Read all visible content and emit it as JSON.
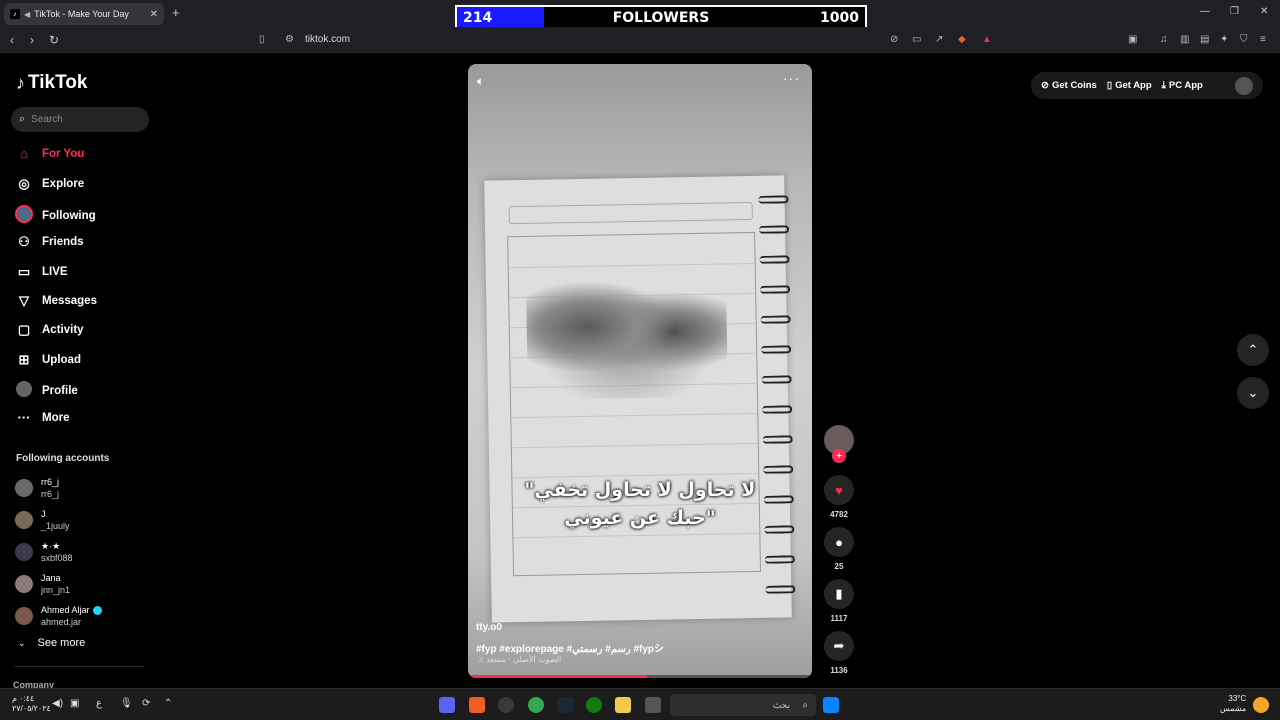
{
  "browser": {
    "tab_title": "TikTok - Make Your Day",
    "url": "tiktok.com"
  },
  "overlay": {
    "current": "214",
    "label": "FOLLOWERS",
    "goal": "1000",
    "progress": 0.214
  },
  "sidebar": {
    "logo": "TikTok",
    "search_placeholder": "Search",
    "nav": [
      {
        "label": "For You",
        "icon": "home-icon"
      },
      {
        "label": "Explore",
        "icon": "compass-icon"
      },
      {
        "label": "Following",
        "icon": "following-avatar-icon"
      },
      {
        "label": "Friends",
        "icon": "friends-icon"
      },
      {
        "label": "LIVE",
        "icon": "live-tv-icon"
      },
      {
        "label": "Messages",
        "icon": "send-icon"
      },
      {
        "label": "Activity",
        "icon": "activity-icon"
      },
      {
        "label": "Upload",
        "icon": "plus-square-icon"
      },
      {
        "label": "Profile",
        "icon": "profile-avatar-icon"
      },
      {
        "label": "More",
        "icon": "more-dots-icon"
      }
    ],
    "following_title": "Following accounts",
    "accounts": [
      {
        "name": "rr6_j",
        "handle": "rr6_j"
      },
      {
        "name": "J",
        "handle": "_1juuly"
      },
      {
        "name": "★·★",
        "handle": "sxbf088"
      },
      {
        "name": "Jana",
        "handle": "jnn_jn1"
      },
      {
        "name": "Ahmed Aljar",
        "handle": "ahmed.jar",
        "verified": true
      }
    ],
    "see_more": "See more",
    "company": "Company"
  },
  "video": {
    "caption_line1": "\"لا تحاول لا تحاول تخفي",
    "caption_line2": "حبك عن عيوني\"",
    "username": "tty.o0",
    "hashtags": "#fyp #explorepage #رسم# رسمتي #fypシ",
    "music": "♫ الصوت الأصلي - مسعد"
  },
  "actions": {
    "likes": "4782",
    "comments": "25",
    "saves": "1117",
    "shares": "1136"
  },
  "topright": {
    "get_coins": "Get Coins",
    "get_app": "Get App",
    "pc_app": "PC App"
  },
  "taskbar": {
    "time": "٠:٤٤ م",
    "date": "٢٧/٠٥/٢٠٢٤",
    "search": "بحث",
    "temp": "33°C",
    "weather": "مشمس"
  },
  "colors": {
    "accent": "#fe2c55",
    "overlay_fill": "#1a1aff"
  }
}
